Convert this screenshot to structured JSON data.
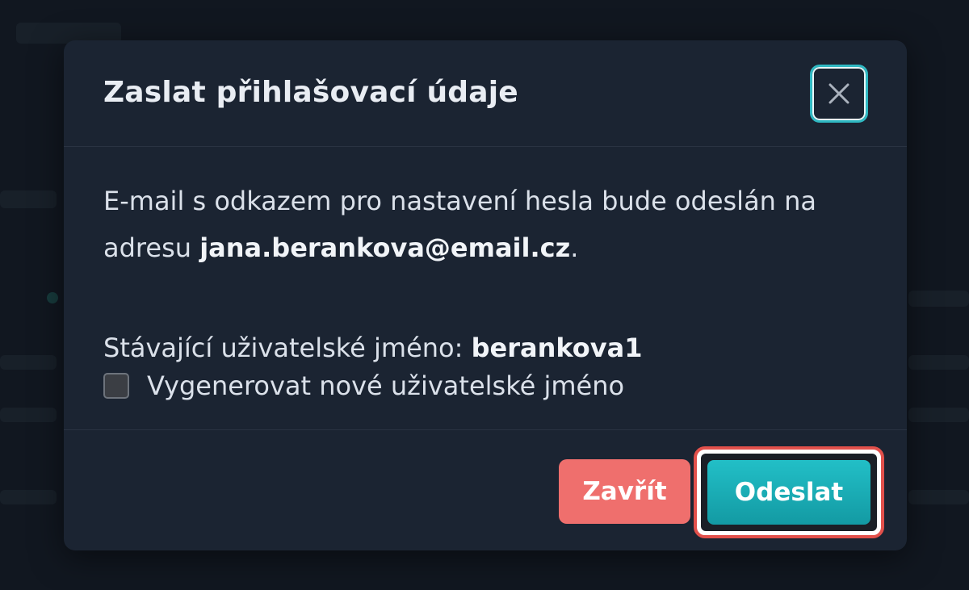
{
  "dialog": {
    "title": "Zaslat přihlašovací údaje",
    "close_icon": "close-icon",
    "message_prefix": "E-mail s odkazem pro nastavení hesla bude odeslán na adresu ",
    "email": "jana.berankova@email.cz",
    "message_suffix": ".",
    "username_label": "Stávající uživatelské jméno: ",
    "username": "berankova1",
    "checkbox_label": "Vygenerovat nové uživatelské jméno",
    "checkbox_checked": false,
    "close_button_label": "Zavřít",
    "send_button_label": "Odeslat"
  },
  "colors": {
    "modal_bg": "#1b2432",
    "accent": "#1fb5bf",
    "danger": "#ef6f6d",
    "highlight": "#e2504b"
  }
}
